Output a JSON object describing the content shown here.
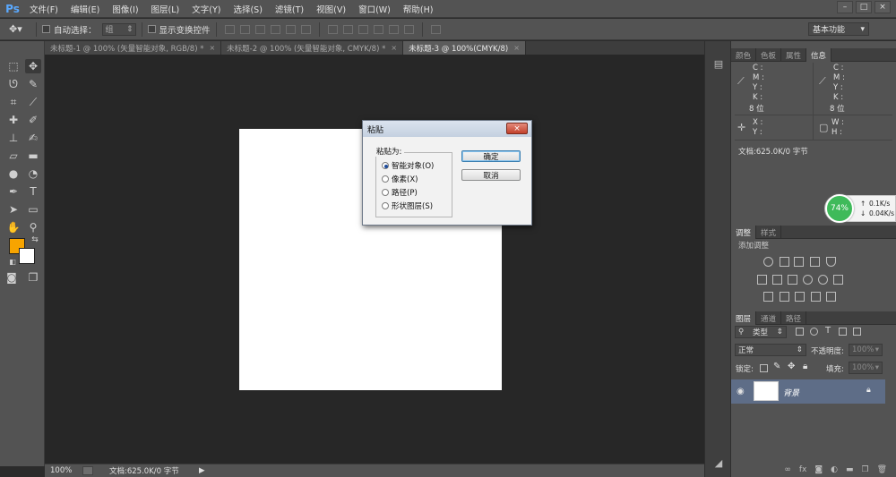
{
  "app": {
    "logo": "Ps"
  },
  "menu": [
    "文件(F)",
    "编辑(E)",
    "图像(I)",
    "图层(L)",
    "文字(Y)",
    "选择(S)",
    "滤镜(T)",
    "视图(V)",
    "窗口(W)",
    "帮助(H)"
  ],
  "window_controls": {
    "minimize": "–",
    "restore": "□",
    "close": "×"
  },
  "options_bar": {
    "auto_select_label": "自动选择：",
    "auto_select_value": "组",
    "show_transform_label": "显示变换控件",
    "workspace": "基本功能"
  },
  "tabs": [
    {
      "label": "未标题-1 @ 100% (矢量智能对象, RGB/8) *",
      "active": false
    },
    {
      "label": "未标题-2 @ 100% (矢量智能对象, CMYK/8) *",
      "active": false
    },
    {
      "label": "未标题-3 @ 100%(CMYK/8)",
      "active": true
    }
  ],
  "colors": {
    "foreground": "#f7a400",
    "background": "#ffffff",
    "selected_layer": "#5e6d87"
  },
  "status": {
    "zoom": "100%",
    "doc_info": "文档:625.0K/0 字节"
  },
  "panels": {
    "top_tabs": [
      "颜色",
      "色板",
      "属性",
      "信息"
    ],
    "info": {
      "cmyk_labels": [
        "C :",
        "M :",
        "Y :",
        "K :"
      ],
      "bit_depth": "8 位",
      "xy_labels": [
        "X :",
        "Y :"
      ],
      "wh_labels": [
        "W :",
        "H :"
      ],
      "doc_info": "文档:625.0K/0 字节"
    },
    "network": {
      "percent": "74%",
      "up": "0.1K/s",
      "down": "0.04K/s"
    },
    "adjust_tabs": [
      "调整",
      "样式"
    ],
    "add_adjustment": "添加调整",
    "layer_tabs": [
      "图层",
      "通道",
      "路径"
    ],
    "layers": {
      "filter_kind": "类型",
      "blend_mode": "正常",
      "opacity_label": "不透明度:",
      "opacity_value": "100%",
      "lock_label": "锁定:",
      "fill_label": "填充:",
      "fill_value": "100%",
      "background_layer": "背景"
    }
  },
  "paste_dialog": {
    "title": "粘贴",
    "close": "×",
    "group_label": "粘贴为:",
    "options": [
      {
        "label": "智能对象(O)",
        "selected": true
      },
      {
        "label": "像素(X)",
        "selected": false
      },
      {
        "label": "路径(P)",
        "selected": false
      },
      {
        "label": "形状图层(S)",
        "selected": false
      }
    ],
    "ok": "确定",
    "cancel": "取消"
  }
}
